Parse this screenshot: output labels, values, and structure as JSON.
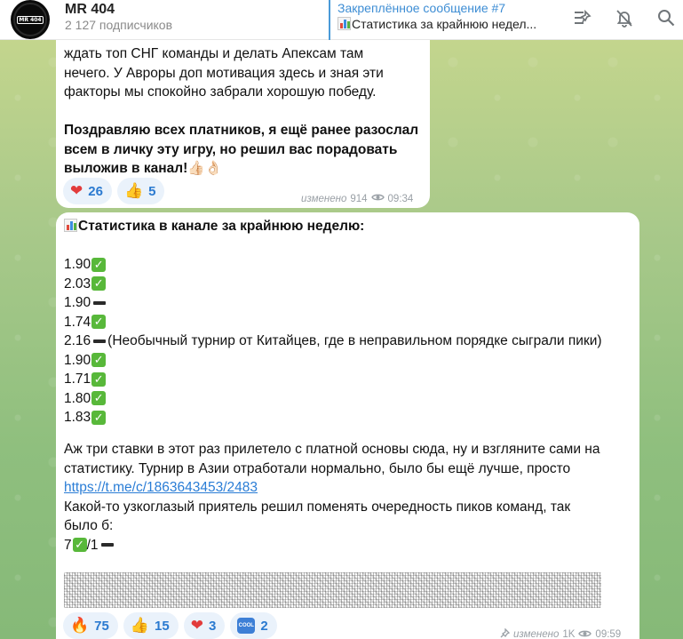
{
  "header": {
    "channel_name": "MR 404",
    "subscribers": "2 127 подписчиков",
    "avatar_text": "MR 404",
    "pinned_title": "Закреплённое сообщение #7",
    "pinned_text": "Статистика за крайнюю недел..."
  },
  "icons": [
    "pin-list-icon",
    "bell-muted-icon",
    "search-icon"
  ],
  "message1": {
    "lines": [
      "ждать топ СНГ команды и делать Апексам там",
      "нечего. У Авроры доп мотивация здесь и зная эти",
      "факторы мы спокойно забрали хорошую победу."
    ],
    "bold_lines": [
      "Поздравляю всех платников, я ещё ранее разослал",
      "всем в личку эту игру, но решил вас порадовать",
      "выложив в канал!👍🏻👌🏻"
    ],
    "reactions": [
      {
        "emoji": "❤",
        "count": "26"
      },
      {
        "emoji": "👍",
        "count": "5"
      }
    ],
    "edited": "изменено",
    "views": "914",
    "time": "09:34"
  },
  "message2": {
    "heading": "Статистика в канале за крайнюю неделю:",
    "stats": [
      {
        "value": "1.90",
        "mark": "check",
        "note": ""
      },
      {
        "value": "2.03",
        "mark": "check",
        "note": ""
      },
      {
        "value": "1.90",
        "mark": "dash",
        "note": ""
      },
      {
        "value": "1.74",
        "mark": "check",
        "note": ""
      },
      {
        "value": "2.16",
        "mark": "dash",
        "note": "(Необычный турнир от Китайцев, где в неправильном порядке сыграли пики)"
      },
      {
        "value": "1.90",
        "mark": "check",
        "note": ""
      },
      {
        "value": "1.71",
        "mark": "check",
        "note": ""
      },
      {
        "value": "1.80",
        "mark": "check",
        "note": ""
      },
      {
        "value": "1.83",
        "mark": "check",
        "note": ""
      }
    ],
    "para1_line1": "Аж три ставки в этот раз прилетело с платной основы сюда, ну и взгляните сами на",
    "para1_line2": "статистику. Турнир в Азии отработали нормально, было бы ещё лучше, просто",
    "link": "https://t.me/c/1863643453/2483",
    "para2_line1": "Какой-то узкоглазый приятель решил поменять очередность пиков команд, так",
    "para2_line2": "было б:",
    "score_a": "7",
    "score_b": "/1",
    "reactions": [
      {
        "emoji": "🔥",
        "count": "75"
      },
      {
        "emoji": "👍",
        "count": "15"
      },
      {
        "emoji": "❤",
        "count": "3"
      },
      {
        "emoji": "COOL",
        "count": "2"
      }
    ],
    "edited": "изменено",
    "views": "1K",
    "time": "09:59"
  }
}
